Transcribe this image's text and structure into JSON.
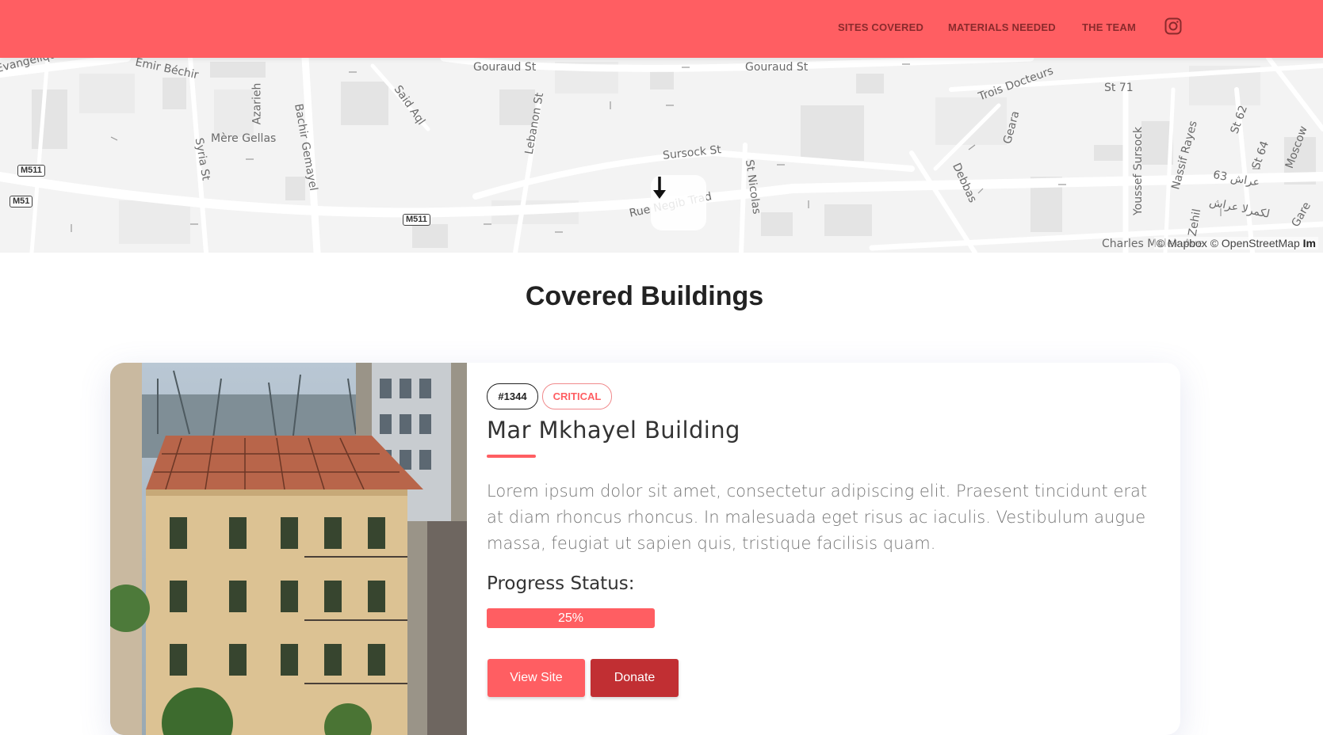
{
  "nav": {
    "links": [
      "SITES COVERED",
      "MATERIALS NEEDED",
      "THE TEAM"
    ],
    "instagram_icon": "instagram-icon"
  },
  "map": {
    "streets": [
      "Emir Béchir",
      "Gouraud St",
      "Gouraud St",
      "Mère Gellas",
      "Azarieh",
      "Bachir Gemayel",
      "Said Aql",
      "Lebanon St",
      "Sursock St",
      "St Nicolas",
      "Rue Negib Trad",
      "Trois Docteurs",
      "St 71",
      "Geara",
      "Debbas",
      "Youssef Sursock",
      "Nassif Rayes",
      "St 64",
      "Moscow",
      "Syria St",
      "Evangélique",
      "Charles Malek Ave",
      "Gare",
      "Zehil",
      "St 62",
      "عراش 63",
      "لكمرلا عراش"
    ],
    "shields": [
      "M511",
      "M51",
      "M511"
    ],
    "attribution": "© Mapbox © OpenStreetMap",
    "attribution_extra": "Im",
    "scroll_icon": "arrow-down-icon"
  },
  "section": {
    "title": "Covered Buildings"
  },
  "building": {
    "id": "#1344",
    "status": "CRITICAL",
    "name": "Mar Mkhayel Building",
    "description": "Lorem ipsum dolor sit amet, consectetur adipiscing elit. Praesent tincidunt erat at diam rhoncus rhoncus. In malesuada eget risus ac iaculis. Vestibulum augue massa, feugiat ut sapien quis, tristique facilisis quam.",
    "progress_label": "Progress Status:",
    "progress_value": 0.25,
    "progress_text": "25%",
    "view_button": "View Site",
    "donate_button": "Donate"
  },
  "colors": {
    "accent": "#ff5e62",
    "donate": "#c12f33",
    "map_bg": "#f3f3f3"
  }
}
